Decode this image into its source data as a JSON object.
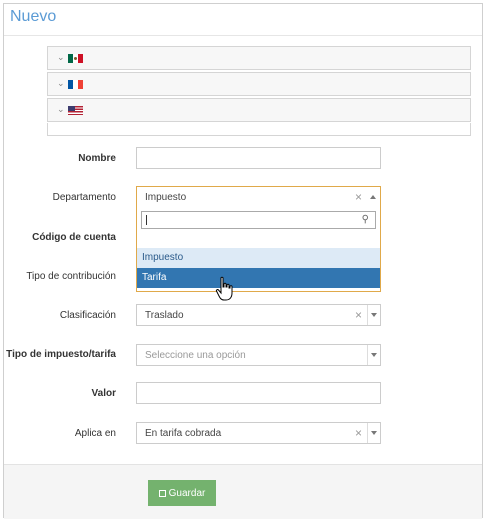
{
  "title": "Nuevo",
  "languages": [
    {
      "flag": "mexico-flag"
    },
    {
      "flag": "france-flag"
    },
    {
      "flag": "usa-flag"
    }
  ],
  "fields": {
    "nombre": {
      "label": "Nombre",
      "value": ""
    },
    "departamento": {
      "label": "Departamento",
      "value": "Impuesto",
      "search_value": "",
      "options": [
        "Impuesto",
        "Tarifa"
      ]
    },
    "codigo_cuenta": {
      "label": "Código de cuenta"
    },
    "tipo_contribucion": {
      "label": "Tipo de contribución"
    },
    "clasificacion": {
      "label": "Clasificación",
      "value": "Traslado"
    },
    "tipo_impuesto": {
      "label": "Tipo de impuesto/tarifa",
      "placeholder": "Seleccione una opción"
    },
    "valor": {
      "label": "Valor",
      "value": ""
    },
    "aplica_en": {
      "label": "Aplica en",
      "value": "En tarifa cobrada"
    }
  },
  "footer": {
    "save_label": "Guardar"
  },
  "colors": {
    "title": "#5b9bd5",
    "save_button": "#74b26e",
    "option_selected": "#3276b1",
    "focus_border": "#e0a94a"
  }
}
